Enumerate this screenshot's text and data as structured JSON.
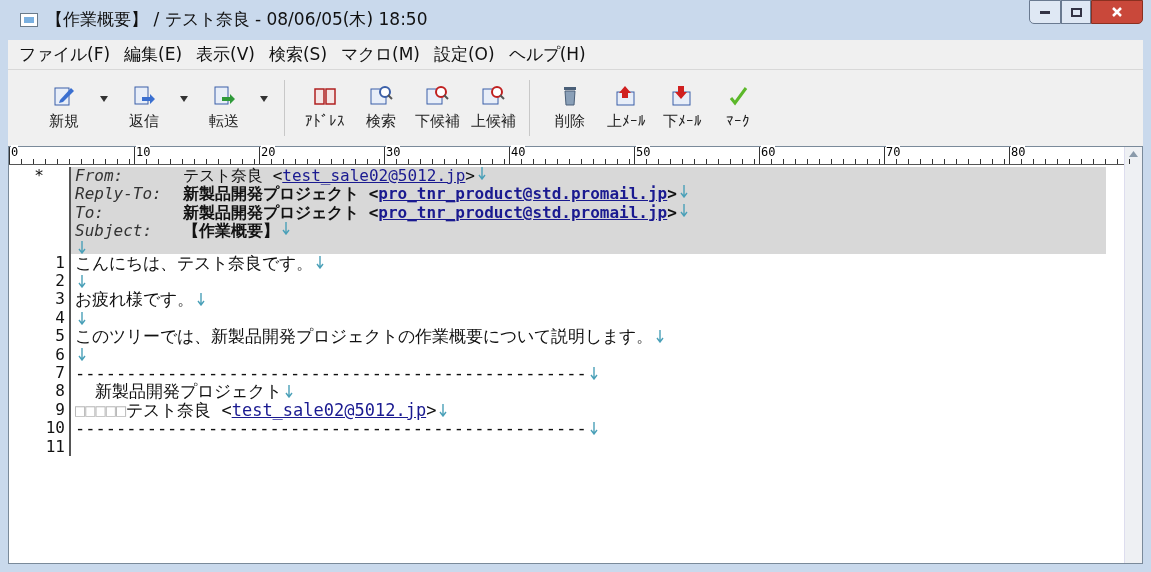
{
  "window": {
    "title": "【作業概要】 / テスト奈良 - 08/06/05(木) 18:50"
  },
  "menu": [
    "ファイル(F)",
    "編集(E)",
    "表示(V)",
    "検索(S)",
    "マクロ(M)",
    "設定(O)",
    "ヘルプ(H)"
  ],
  "toolbar": [
    [
      {
        "kind": "new",
        "label": "新規",
        "dropdown": true
      },
      {
        "kind": "reply",
        "label": "返信",
        "dropdown": true
      },
      {
        "kind": "forward",
        "label": "転送",
        "dropdown": true
      }
    ],
    [
      {
        "kind": "address",
        "label": "ｱﾄﾞﾚｽ",
        "dropdown": false
      },
      {
        "kind": "search",
        "label": "検索",
        "dropdown": false
      },
      {
        "kind": "next",
        "label": "下候補",
        "dropdown": false
      },
      {
        "kind": "prev",
        "label": "上候補",
        "dropdown": false
      }
    ],
    [
      {
        "kind": "delete",
        "label": "削除",
        "dropdown": false
      },
      {
        "kind": "up",
        "label": "上ﾒｰﾙ",
        "dropdown": false
      },
      {
        "kind": "down",
        "label": "下ﾒｰﾙ",
        "dropdown": false
      },
      {
        "kind": "mark",
        "label": "ﾏｰｸ",
        "dropdown": false
      }
    ]
  ],
  "ruler": [
    "0",
    "10",
    "20",
    "30",
    "40",
    "50",
    "60",
    "70",
    "80"
  ],
  "header_marker": "*",
  "header": [
    {
      "key": "From:",
      "bold": false,
      "eol": true,
      "segments": [
        {
          "kind": "plain",
          "text": "テスト奈良 <"
        },
        {
          "kind": "link",
          "text": "test_sale02@5012.jp"
        },
        {
          "kind": "plain",
          "text": ">"
        }
      ]
    },
    {
      "key": "Reply-To:",
      "bold": true,
      "eol": true,
      "segments": [
        {
          "kind": "plain",
          "text": "新製品開発プロジェクト <"
        },
        {
          "kind": "link",
          "text": "pro_tnr_product@std.promail.jp"
        },
        {
          "kind": "plain",
          "text": ">"
        }
      ]
    },
    {
      "key": "To:",
      "bold": true,
      "eol": true,
      "segments": [
        {
          "kind": "plain",
          "text": "新製品開発プロジェクト <"
        },
        {
          "kind": "link",
          "text": "pro_tnr_product@std.promail.jp"
        },
        {
          "kind": "plain",
          "text": ">"
        }
      ]
    },
    {
      "key": "Subject:",
      "bold": true,
      "eol": true,
      "segments": [
        {
          "kind": "plain",
          "text": "【作業概要】"
        }
      ]
    },
    {
      "eol": true
    }
  ],
  "lines": [
    {
      "number": "1",
      "eol": true,
      "segments": [
        {
          "kind": "plain",
          "text": "こんにちは、テスト奈良です。"
        }
      ]
    },
    {
      "number": "2",
      "eol": true
    },
    {
      "number": "3",
      "eol": true,
      "segments": [
        {
          "kind": "plain",
          "text": "お疲れ様です。"
        }
      ]
    },
    {
      "number": "4",
      "eol": true
    },
    {
      "number": "5",
      "eol": true,
      "segments": [
        {
          "kind": "plain",
          "text": "このツリーでは、新製品開発プロジェクトの作業概要について説明します。"
        }
      ]
    },
    {
      "number": "6",
      "eol": true
    },
    {
      "number": "7",
      "eol": true,
      "segments": [
        {
          "kind": "plain",
          "text": "--------------------------------------------------"
        }
      ]
    },
    {
      "number": "8",
      "eol": true,
      "segments": [
        {
          "kind": "plain",
          "text": "  新製品開発プロジェクト"
        }
      ]
    },
    {
      "number": "9",
      "eol": true,
      "segments": [
        {
          "kind": "space_marks",
          "text": "□□□□□"
        },
        {
          "kind": "plain",
          "text": "テスト奈良 <"
        },
        {
          "kind": "link",
          "text": "test_sale02@5012.jp"
        },
        {
          "kind": "plain",
          "text": ">"
        }
      ]
    },
    {
      "number": "10",
      "eol": true,
      "segments": [
        {
          "kind": "plain",
          "text": "--------------------------------------------------"
        }
      ]
    },
    {
      "number": "11",
      "eol": false
    }
  ]
}
